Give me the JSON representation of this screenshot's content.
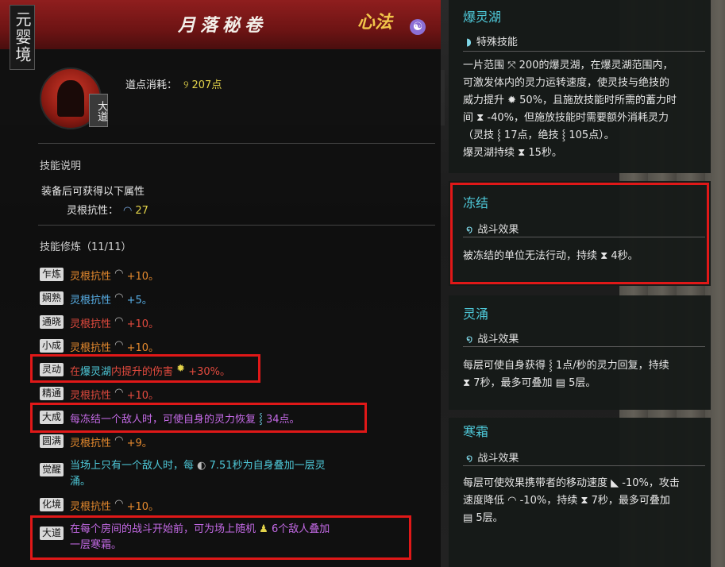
{
  "header": {
    "realm": "元婴境",
    "title": "月落秘卷",
    "category": "心法"
  },
  "avatar": {
    "badge": "大道"
  },
  "cost": {
    "label": "道点消耗：",
    "value": "207点"
  },
  "skill_desc": {
    "label": "技能说明",
    "equip_text": "装备后可获得以下属性",
    "attr_name": "灵根抗性：",
    "attr_value": "27"
  },
  "training": {
    "label": "技能修炼（11/11）",
    "rows": [
      {
        "tag": "乍炼",
        "name": "灵根抗性",
        "value": "+10。"
      },
      {
        "tag": "娴熟",
        "name": "灵根抗性",
        "value": "+5。"
      },
      {
        "tag": "通晓",
        "name": "灵根抗性",
        "value": "+10。"
      },
      {
        "tag": "小成",
        "name": "灵根抗性",
        "value": "+10。"
      },
      {
        "tag": "灵动",
        "pre": "在",
        "link": "爆灵湖",
        "post": "内提升的伤害",
        "value": "+30%。"
      },
      {
        "tag": "精通",
        "name": "灵根抗性",
        "value": "+10。"
      },
      {
        "tag": "大成",
        "text": "每冻结一个敌人时，可使自身的灵力恢复",
        "value": "34点。"
      },
      {
        "tag": "圆满",
        "name": "灵根抗性",
        "value": "+9。"
      },
      {
        "tag": "觉醒",
        "text_a": "当场上只有一个敌人时，每",
        "value": "7.51秒为自身叠加一层灵",
        "text_b": "涌。"
      },
      {
        "tag": "化境",
        "name": "灵根抗性",
        "value": "+10。"
      },
      {
        "tag": "大道",
        "text_a": "在每个房间的战斗开始前，可为场上随机",
        "value": "6个敌人叠加",
        "text_b": "一层寒霜。"
      }
    ]
  },
  "right_cards": [
    {
      "title": "爆灵湖",
      "subtitle": "特殊技能",
      "lines": [
        "一片范围 ⤧ 200的爆灵湖，在爆灵湖范围内，",
        "可激发体内的灵力运转速度，使灵技与绝技的",
        "威力提升 ✹ 50%，且施放技能时所需的蓄力时",
        "间 ⧗ -40%，但施放技能时需要额外消耗灵力",
        "（灵技 ⸾ 17点，绝技 ⸾ 105点）。",
        "爆灵湖持续 ⧗ 15秒。"
      ]
    },
    {
      "title": "冻结",
      "subtitle": "战斗效果",
      "lines": [
        "被冻结的单位无法行动，持续 ⧗ 4秒。"
      ]
    },
    {
      "title": "灵涌",
      "subtitle": "战斗效果",
      "lines": [
        "每层可使自身获得 ⸾ 1点/秒的灵力回复，持续",
        "⧗ 7秒，最多可叠加 ▤ 5层。"
      ]
    },
    {
      "title": "寒霜",
      "subtitle": "战斗效果",
      "lines": [
        "每层可使效果携带者的移动速度 ◣ -10%，攻击",
        "速度降低 ◠ -10%，持续 ⧗ 7秒，最多可叠加",
        "▤ 5层。"
      ]
    }
  ],
  "colors": {
    "accent_red": "#e01818",
    "teal": "#4ec8d8",
    "yellow": "#e4d44a",
    "orange": "#e68a2e"
  }
}
